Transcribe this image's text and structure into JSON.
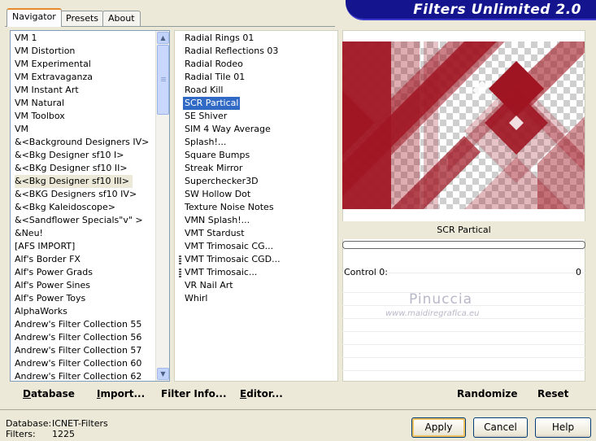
{
  "window": {
    "title": "Filters Unlimited 2.0"
  },
  "tabs": [
    {
      "label": "Navigator",
      "active": true
    },
    {
      "label": "Presets",
      "active": false
    },
    {
      "label": "About",
      "active": false
    }
  ],
  "categories": [
    "VM 1",
    "VM Distortion",
    "VM Experimental",
    "VM Extravaganza",
    "VM Instant Art",
    "VM Natural",
    "VM Toolbox",
    "VM",
    "&<Background Designers IV>",
    "&<Bkg Designer sf10 I>",
    "&<BKg Designer sf10 II>",
    "&<Bkg Designer sf10 III>",
    "&<BKG Designers sf10 IV>",
    "&<Bkg Kaleidoscope>",
    "&<Sandflower Specials\"v\" >",
    "&Neu!",
    "[AFS IMPORT]",
    "Alf's Border FX",
    "Alf's Power Grads",
    "Alf's Power Sines",
    "Alf's Power Toys",
    "AlphaWorks",
    "Andrew's Filter Collection 55",
    "Andrew's Filter Collection 56",
    "Andrew's Filter Collection 57",
    "Andrew's Filter Collection 60",
    "Andrew's Filter Collection 62"
  ],
  "selected_category_index": 11,
  "filters": [
    "Radial  Rings 01",
    "Radial Reflections 03",
    "Radial Rodeo",
    "Radial Tile 01",
    "Road Kill",
    "SCR  Partical",
    "SE Shiver",
    "SIM 4 Way Average",
    "Splash!...",
    "Square Bumps",
    "Streak Mirror",
    "Superchecker3D",
    "SW Hollow Dot",
    "Texture Noise Notes",
    "VMN Splash!...",
    "VMT Stardust",
    "VMT Trimosaic CG...",
    "VMT Trimosaic CGD...",
    "VMT Trimosaic...",
    "VR Nail Art",
    "Whirl"
  ],
  "selected_filter_index": 5,
  "marked_filter_indices": [
    17,
    18
  ],
  "preview": {
    "filter_name": "SCR  Partical",
    "progress": 0,
    "control_label": "Control 0:",
    "control_value": "0",
    "accent_color": "#a01522"
  },
  "watermark": {
    "name": "Pinuccia",
    "site": "www.maidiregrafica.eu"
  },
  "left_buttons": [
    {
      "label": "Database",
      "underline": "D",
      "rest": "atabase"
    },
    {
      "label": "Import...",
      "underline": "I",
      "rest": "mport..."
    },
    {
      "label": "Filter Info...",
      "underline": "",
      "rest": "Filter Info..."
    },
    {
      "label": "Editor...",
      "underline": "E",
      "rest": "ditor..."
    }
  ],
  "right_buttons": {
    "randomize": "Randomize",
    "reset": "Reset"
  },
  "status": {
    "database_label": "Database:",
    "database_value": "ICNET-Filters",
    "filters_label": "Filters:",
    "filters_value": "1225"
  },
  "dialog_buttons": {
    "apply": "Apply",
    "cancel": "Cancel",
    "help": "Help"
  }
}
